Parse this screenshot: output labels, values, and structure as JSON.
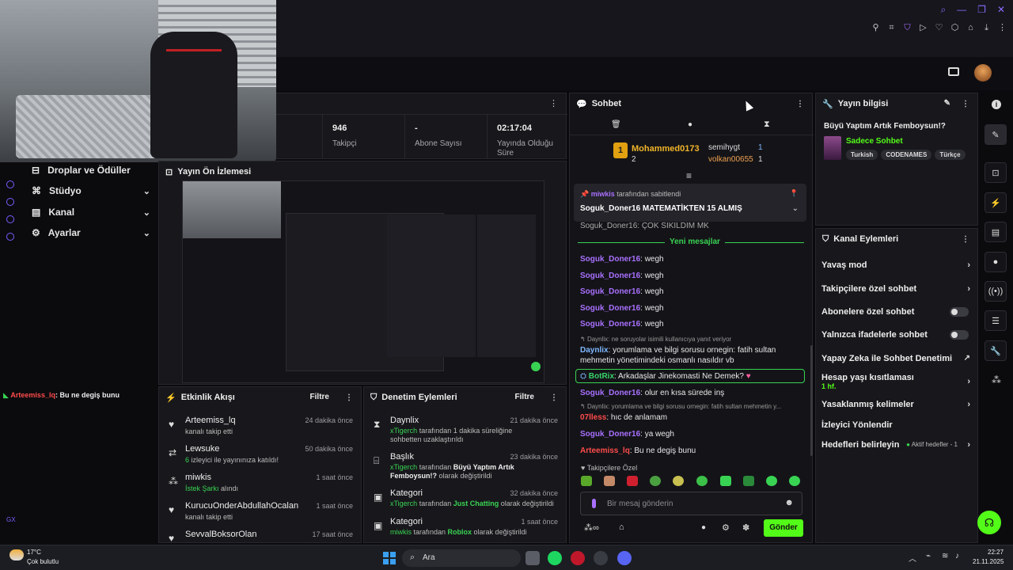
{
  "header": {
    "avatar_alt": "avatar"
  },
  "left_nav": {
    "items": [
      {
        "label": "Droplar ve Ödüller"
      },
      {
        "label": "Stüdyo"
      },
      {
        "label": "Kanal"
      },
      {
        "label": "Ayarlar"
      }
    ],
    "overlay_user": "Arteemiss_lq",
    "overlay_msg": ": Bu ne degiş bunu",
    "gx_label": "GX"
  },
  "stats": [
    {
      "value": "946",
      "label": "Takipçi"
    },
    {
      "value": "-",
      "label": "Abone Sayısı"
    },
    {
      "value": "02:17:04",
      "label": "Yayında Olduğu Süre"
    }
  ],
  "preview": {
    "title": "Yayın Ön İzlemesi"
  },
  "activity": {
    "title": "Etkinlik Akışı",
    "filter": "Filtre",
    "items": [
      {
        "name": "Arteemiss_lq",
        "detail": "kanalı takip etti",
        "time": "24 dakika önce",
        "icon": "heart-icon"
      },
      {
        "name": "Lewsuke",
        "detail_green": "6",
        "detail": " izleyici ile yayınınıza katıldı!",
        "time": "50 dakika önce",
        "icon": "raid-icon"
      },
      {
        "name": "miwkis",
        "detail_green": "İstek Şarkı",
        "detail": " alındı",
        "time": "1 saat önce",
        "icon": "points-icon"
      },
      {
        "name": "KurucuOnderAbdullahOcalan",
        "detail": "kanalı takip etti",
        "time": "1 saat önce",
        "icon": "heart-icon"
      },
      {
        "name": "SevvalBoksorOlan",
        "detail": "",
        "time": "17 saat önce",
        "icon": "heart-icon"
      }
    ]
  },
  "moderation": {
    "title": "Denetim Eylemleri",
    "filter": "Filtre",
    "items": [
      {
        "title": "Daynlix",
        "mod": "xTigerch",
        "text": " tarafından 1 dakika süreliğine sohbetten uzaklaştırıldı",
        "time": "21 dakika önce"
      },
      {
        "title": "Başlık",
        "mod": "xTigerch",
        "text": " tarafından ",
        "bold": "Büyü Yaptım Artık Femboysun!?",
        "text2": " olarak değiştirildi",
        "time": "23 dakika önce"
      },
      {
        "title": "Kategori",
        "mod": "xTigerch",
        "text": " tarafından ",
        "bold": "Just Chatting",
        "text2": " olarak değiştirildi",
        "time": "32 dakika önce"
      },
      {
        "title": "Kategori",
        "mod": "miwkis",
        "text": " tarafından ",
        "bold": "Roblox",
        "text2": " olarak değiştirildi",
        "time": "1 saat önce"
      }
    ]
  },
  "chat": {
    "title": "Sohbet",
    "leaderboard": {
      "first_name": "Mohammed0173",
      "first_rank": "1",
      "first_count": "2",
      "second_name": "semihygt",
      "second_count": "1",
      "third_name": "volkan00655",
      "third_count": "1"
    },
    "pinned": {
      "by": "miwkis",
      "by_suffix": " tarafından sabitlendi",
      "text": "Soguk_Doner16 MATEMATİKTEN 15 ALMIŞ"
    },
    "partial_line": "Soguk_Doner16: ÇOK SIKILDIM MK",
    "new_messages": "Yeni mesajlar",
    "messages": [
      {
        "user": "Soguk_Doner16",
        "text": ": wegh"
      },
      {
        "user": "Soguk_Doner16",
        "text": ": wegh"
      },
      {
        "user": "Soguk_Doner16",
        "text": ": wegh"
      },
      {
        "user": "Soguk_Doner16",
        "text": ": wegh"
      },
      {
        "user": "Soguk_Doner16",
        "text": ": wegh"
      }
    ],
    "reply1_ref": "Daynlix: ne soruyolar isimili kullanıcıya yanıt veriyor",
    "reply1_user": "Daynlix",
    "reply1_text": ": yorumlama ve bilgi sorusu ornegin: fatih sultan mehmetin yönetimindeki osmanlı nasıldır vb",
    "bot_user": "BotRix",
    "bot_text": ": Arkadaşlar Jinekomasti Ne Demek?",
    "msg_soguk2_user": "Soguk_Doner16",
    "msg_soguk2_text": ": olur en kısa sürede inş",
    "reply2_ref": "Daynlix: yorumlama ve bilgi sorusu ornegin: fatih sultan mehmetin y...",
    "msg_07_user": "07lless",
    "msg_07_text": ": hıc de anlamam",
    "msg_soguk3_user": "Soguk_Doner16",
    "msg_soguk3_text": ": ya wegh",
    "msg_art_user": "Arteemiss_lq",
    "msg_art_text": ": Bu ne degiş bunu",
    "emote_label": "Takipçilere Özel",
    "input_placeholder": "Bir mesaj gönderin",
    "send_label": "Gönder"
  },
  "stream_info": {
    "title": "Yayın bilgisi",
    "stream_title": "Büyü Yaptım Artık Femboysun!?",
    "category": "Sadece Sohbet",
    "tags": [
      "Turkish",
      "CODENAMES",
      "Türkçe"
    ]
  },
  "channel_actions": {
    "title": "Kanal Eylemleri",
    "slow": "Yavaş mod",
    "followers": "Takipçilere özel sohbet",
    "subs": "Abonelere özel sohbet",
    "emotes": "Yalnızca ifadelerle sohbet",
    "ai": "Yapay Zeka ile Sohbet Denetimi",
    "age": "Hesap yaşı kısıtlaması",
    "age_value": "1 hf.",
    "banned": "Yasaklanmış kelimeler",
    "redirect": "İzleyici Yönlendir",
    "goals": "Hedefleri belirleyin",
    "goals_status": "Aktif hedefler - 1"
  },
  "taskbar": {
    "temp": "17°C",
    "weather": "Çok bulutlu",
    "search": "Ara",
    "time": "22:27",
    "date": "21.11.2025"
  },
  "colors": {
    "accent": "#53fc18",
    "brand_purple": "#a970ff",
    "bg": "#0b0b0e",
    "panel": "#18181c"
  }
}
